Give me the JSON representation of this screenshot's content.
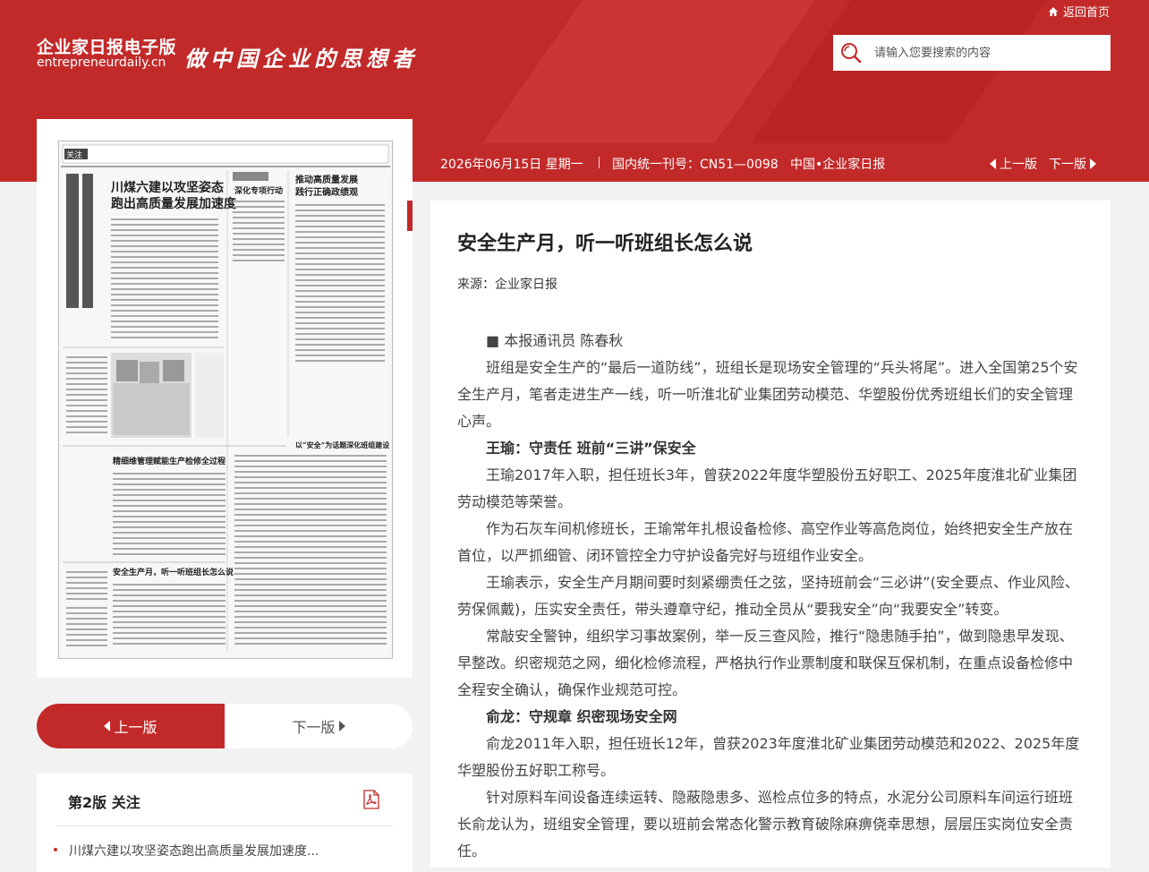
{
  "header": {
    "home_link": "返回首页",
    "logo_cn": "企业家日报电子版",
    "logo_en": "entrepreneurdaily.cn",
    "slogan": "做中国企业的思想者",
    "search_placeholder": "请输入您要搜索的内容"
  },
  "infobar": {
    "date": "2026年06月15日 星期一",
    "issn": "国内统一刊号：CN51—0098",
    "org": "中国•企业家日报",
    "prev": "上一版",
    "next": "下一版"
  },
  "paper_thumb": {
    "masthead_left": "关注",
    "headline_1": "川煤六建以攻坚姿态跑出高质量发展加速度",
    "headline_2": "安全生产月，听一听班组长怎么说",
    "headline_3": "精细维管理赋能生产检修全过程",
    "headline_4": "以“安全”为话题深化班组建设"
  },
  "pager": {
    "prev": "上一版",
    "next": "下一版"
  },
  "toc": {
    "title": "第2版 关注",
    "items": [
      "川煤六建以攻坚姿态跑出高质量发展加速度..."
    ]
  },
  "article": {
    "title": "安全生产月，听一听班组长怎么说",
    "source": "来源：企业家日报",
    "paragraphs": [
      {
        "type": "text",
        "text": "■ 本报通讯员 陈春秋"
      },
      {
        "type": "text",
        "text": "班组是安全生产的“最后一道防线”，班组长是现场安全管理的“兵头将尾”。进入全国第25个安全生产月，笔者走进生产一线，听一听淮北矿业集团劳动模范、华塑股份优秀班组长们的安全管理心声。"
      },
      {
        "type": "sub",
        "text": "王瑜：守责任 班前“三讲”保安全"
      },
      {
        "type": "text",
        "text": "王瑜2017年入职，担任班长3年，曾获2022年度华塑股份五好职工、2025年度淮北矿业集团劳动模范等荣誉。"
      },
      {
        "type": "text",
        "text": "作为石灰车间机修班长，王瑜常年扎根设备检修、高空作业等高危岗位，始终把安全生产放在首位，以严抓细管、闭环管控全力守护设备完好与班组作业安全。"
      },
      {
        "type": "text",
        "text": "王瑜表示，安全生产月期间要时刻紧绷责任之弦，坚持班前会“三必讲”(安全要点、作业风险、劳保佩戴)，压实安全责任，带头遵章守纪，推动全员从“要我安全”向“我要安全”转变。"
      },
      {
        "type": "text",
        "text": "常敲安全警钟，组织学习事故案例，举一反三查风险，推行“隐患随手拍”，做到隐患早发现、早整改。织密规范之网，细化检修流程，严格执行作业票制度和联保互保机制，在重点设备检修中全程安全确认，确保作业规范可控。"
      },
      {
        "type": "sub",
        "text": "俞龙：守规章 织密现场安全网"
      },
      {
        "type": "text",
        "text": "俞龙2011年入职，担任班长12年，曾获2023年度淮北矿业集团劳动模范和2022、2025年度华塑股份五好职工称号。"
      },
      {
        "type": "text",
        "text": "针对原料车间设备连续运转、隐蔽隐患多、巡检点位多的特点，水泥分公司原料车间运行班班长俞龙认为，班组安全管理，要以班前会常态化警示教育破除麻痹侥幸思想，层层压实岗位安全责任。"
      }
    ]
  }
}
